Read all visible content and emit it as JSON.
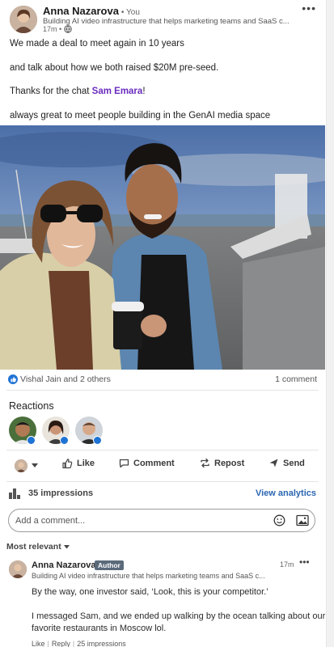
{
  "post": {
    "author_name": "Anna Nazarova",
    "author_degree": "• You",
    "headline": "Building AI video infrastructure that helps marketing teams and SaaS c...",
    "time": "17m •",
    "text_lines": [
      "We made a deal to meet again in 10 years",
      "and talk about how we both raised $20M pre-seed.",
      "Thanks for the chat",
      "always great to meet people building in the GenAI media space"
    ],
    "mention": "Sam Emara",
    "mention_suffix": "!"
  },
  "social": {
    "likers": "Vishal Jain and 2 others",
    "comments": "1 comment"
  },
  "reactions": {
    "title": "Reactions"
  },
  "actions": {
    "like": "Like",
    "comment": "Comment",
    "repost": "Repost",
    "send": "Send"
  },
  "impressions": {
    "text": "35 impressions",
    "analytics": "View analytics"
  },
  "comment_box": {
    "placeholder": "Add a comment..."
  },
  "sort": {
    "label": "Most relevant"
  },
  "comment": {
    "author_name": "Anna Nazarova",
    "badge": "Author",
    "headline": "Building AI video infrastructure that helps marketing teams and SaaS c...",
    "time": "17m",
    "lines": [
      "By the way, one investor said, ‘Look, this is your competitor.’",
      "I messaged Sam, and we ended up walking by the ocean talking about our",
      "favorite restaurants in Moscow lol."
    ],
    "like": "Like",
    "reply": "Reply",
    "impressions": "25 impressions"
  },
  "colors": {
    "mention": "#6a2cbf",
    "link_blue": "#2a66b1",
    "reaction_blue": "#1f73d4"
  }
}
